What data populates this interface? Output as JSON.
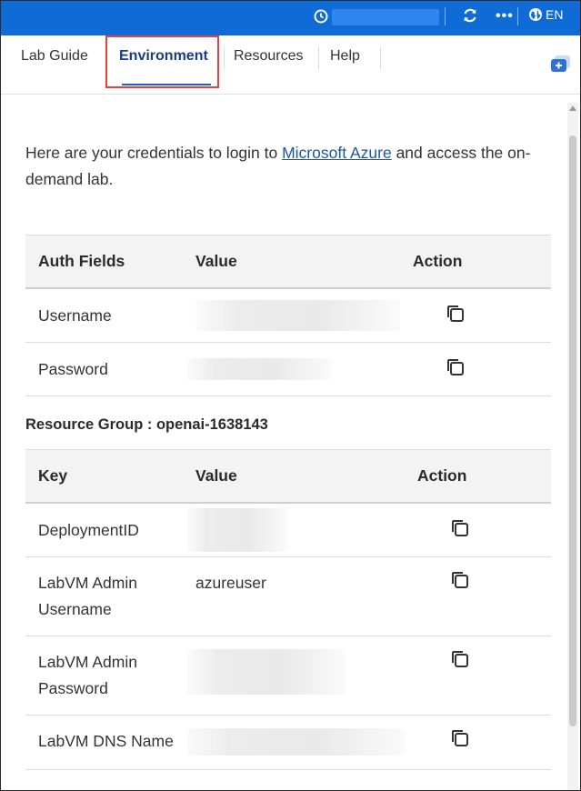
{
  "topbar": {
    "timer_icon": "clock-icon",
    "refresh_icon": "refresh-icon",
    "more_label": "•••",
    "globe_icon": "globe-icon",
    "language": "EN"
  },
  "tabs": [
    {
      "label": "Lab Guide",
      "active": false
    },
    {
      "label": "Environment",
      "active": true
    },
    {
      "label": "Resources",
      "active": false
    },
    {
      "label": "Help",
      "active": false
    }
  ],
  "intro": {
    "before_link": "Here are your credentials to login to ",
    "link_text": "Microsoft Azure",
    "after_link": " and access the on-demand lab."
  },
  "auth_table": {
    "headers": [
      "Auth Fields",
      "Value",
      "Action"
    ],
    "rows": [
      {
        "field": "Username",
        "value": ""
      },
      {
        "field": "Password",
        "value": ""
      }
    ]
  },
  "resource_group": {
    "title": "Resource Group : openai-1638143",
    "headers": [
      "Key",
      "Value",
      "Action"
    ],
    "rows": [
      {
        "key": "DeploymentID",
        "value": ""
      },
      {
        "key": "LabVM Admin Username",
        "value": "azureuser"
      },
      {
        "key": "LabVM Admin Password",
        "value": ""
      },
      {
        "key": "LabVM DNS Name",
        "value": ""
      }
    ]
  },
  "colors": {
    "topbar": "#0f6cd6",
    "active_tab": "#1b3a8a",
    "highlight": "#e34141",
    "link": "#1a56a8"
  }
}
